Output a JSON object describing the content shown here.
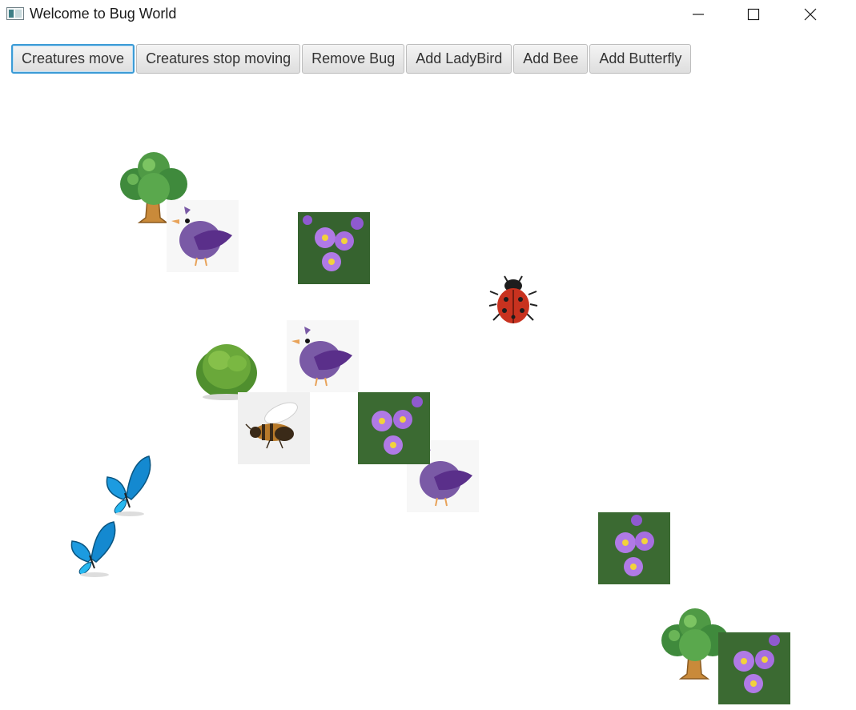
{
  "window": {
    "title": "Welcome to Bug World",
    "icon": "app-icon",
    "controls": [
      "minimize-icon",
      "maximize-icon",
      "close-icon"
    ]
  },
  "toolbar": {
    "buttons": [
      {
        "label": "Creatures move",
        "focused": true
      },
      {
        "label": "Creatures stop moving"
      },
      {
        "label": "Remove Bug"
      },
      {
        "label": "Add LadyBird"
      },
      {
        "label": "Add Bee"
      },
      {
        "label": "Add Butterfly"
      }
    ]
  },
  "world": {
    "creatures": [
      "tree",
      "tree",
      "bush",
      "bird",
      "bird",
      "bird",
      "flowers",
      "flowers",
      "flowers",
      "flowers",
      "ladybird",
      "bee",
      "butterfly",
      "butterfly"
    ]
  },
  "colors": {
    "focus_border": "#3b9bd6",
    "bird": "#7a5aa6",
    "bird_wing": "#5a2f8a",
    "foliage": "#3f8a3c",
    "trunk": "#c98a3a",
    "flower": "#b07ae6",
    "ladybird": "#c8321f",
    "butterfly": "#1c9be0"
  }
}
